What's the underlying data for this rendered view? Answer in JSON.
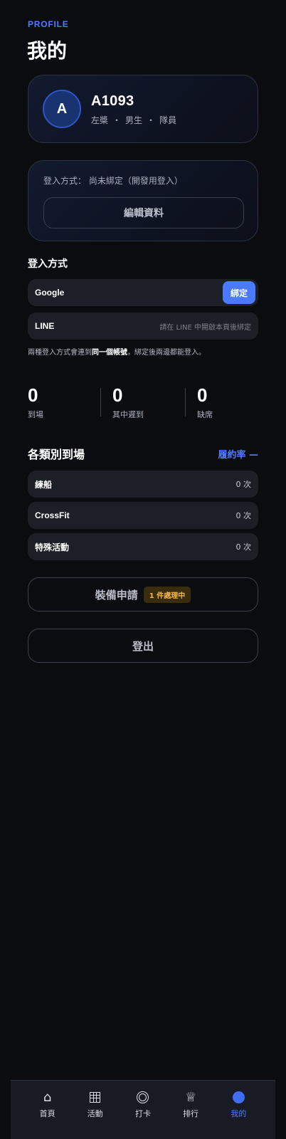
{
  "header": {
    "eyebrow": "PROFILE",
    "title": "我的"
  },
  "profile": {
    "avatar_initial": "A",
    "name": "A1093",
    "meta": [
      "左槳",
      "男生",
      "隊員"
    ]
  },
  "login_card": {
    "status_label": "登入方式：",
    "status_value": "尚未綁定（開發用登入）",
    "edit_label": "編輯資料"
  },
  "login_methods": {
    "title": "登入方式",
    "google": {
      "label": "Google",
      "button": "綁定"
    },
    "line": {
      "label": "LINE",
      "hint": "請在 LINE 中開啟本頁後綁定"
    },
    "note_prefix": "兩種登入方式會連到",
    "note_bold": "同一個帳號",
    "note_suffix": "，綁定後兩邊都能登入。"
  },
  "stats": [
    {
      "value": "0",
      "label": "到場"
    },
    {
      "value": "0",
      "label": "其中遲到"
    },
    {
      "value": "0",
      "label": "缺席"
    }
  ],
  "categories": {
    "title": "各類別到場",
    "rate_label": "履約率 —",
    "items": [
      {
        "label": "練船",
        "count": "0 次"
      },
      {
        "label": "CrossFit",
        "count": "0 次"
      },
      {
        "label": "特殊活動",
        "count": "0 次"
      }
    ]
  },
  "equipment": {
    "label": "裝備申請",
    "badge": "1 件處理中"
  },
  "logout": {
    "label": "登出"
  },
  "nav": {
    "items": [
      {
        "label": "首頁",
        "icon": "home-icon"
      },
      {
        "label": "活動",
        "icon": "calendar-grid-icon"
      },
      {
        "label": "打卡",
        "icon": "checkin-ring-icon"
      },
      {
        "label": "排行",
        "icon": "crown-icon"
      },
      {
        "label": "我的",
        "icon": "profile-dot-icon"
      }
    ],
    "active_color": "#4f7cff"
  },
  "colors": {
    "accent": "#4f7cff",
    "background": "#0b0c0f",
    "badge_text": "#f3b64a"
  }
}
